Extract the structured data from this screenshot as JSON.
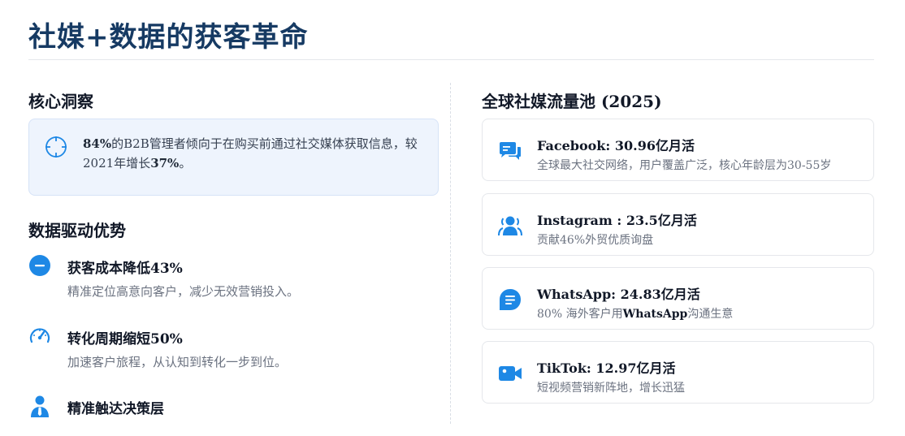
{
  "page": {
    "title": "社媒+数据的获客革命"
  },
  "insight": {
    "heading": "核心洞察",
    "text_pct": "84%",
    "text_main": "的B2B管理者倾向于在购买前通过社交媒体获取信息，较2021年增长",
    "text_growth": "37%",
    "text_end": "。"
  },
  "advantages": {
    "heading": "数据驱动优势",
    "items": [
      {
        "icon": "minus-circle-icon",
        "title": "获客成本降低43%",
        "desc": "精准定位高意向客户，减少无效营销投入。"
      },
      {
        "icon": "speedometer-icon",
        "title": "转化周期缩短50%",
        "desc": "加速客户旅程，从认知到转化一步到位。"
      },
      {
        "icon": "user-tie-icon",
        "title": "精准触达决策层",
        "desc": ""
      }
    ]
  },
  "traffic": {
    "heading": "全球社媒流量池 (2025)",
    "accent": "#1e88e5",
    "items": [
      {
        "icon": "chat-bubbles-icon",
        "title": "Facebook: 30.96亿月活",
        "desc": "全球最大社交网络，用户覆盖广泛，核心年龄层为30-55岁"
      },
      {
        "icon": "users-icon",
        "title": " Instagram : 23.5亿月活",
        "desc": "贡献46%外贸优质询盘"
      },
      {
        "icon": "message-icon",
        "title": "WhatsApp: 24.83亿月活",
        "desc_pre": " 80% 海外客户用",
        "desc_bold": "WhatsApp",
        "desc_post": "沟通生意"
      },
      {
        "icon": "video-camera-icon",
        "title": "TikTok: 12.97亿月活",
        "desc": "短视频营销新阵地，增长迅猛"
      }
    ]
  }
}
